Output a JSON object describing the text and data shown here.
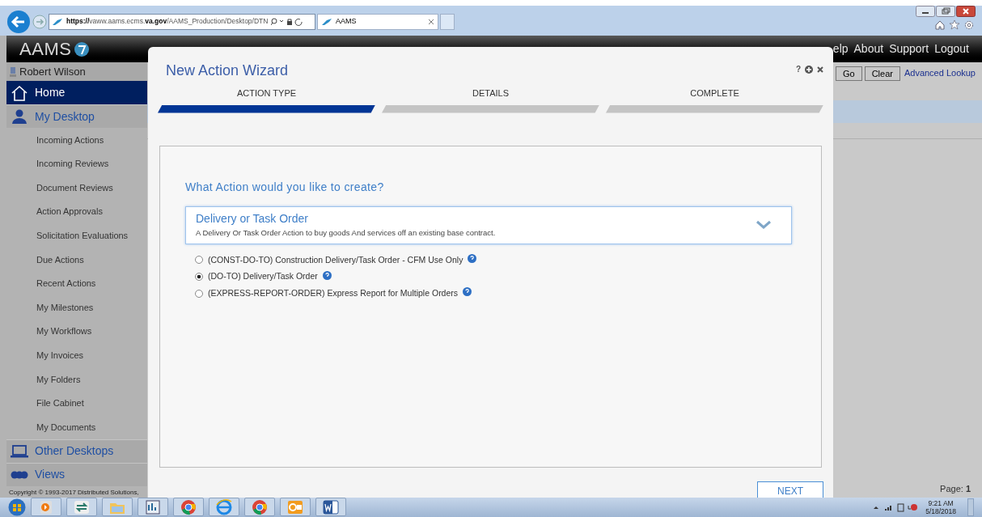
{
  "browser": {
    "address_parts": [
      "https://",
      "vaww.aams.ecms.",
      "va.gov",
      "/AAMS_Production/Desktop/DTN"
    ],
    "tab_title": "AAMS"
  },
  "header": {
    "logo": "AAMS",
    "links": [
      "elp",
      "About",
      "Support",
      "Logout"
    ]
  },
  "lookup": {
    "buttons": [
      "Go",
      "Clear"
    ],
    "link": "Advanced Lookup"
  },
  "sidebar": {
    "user": "Robert Wilson",
    "sections": [
      {
        "label": "Home",
        "selected": true
      },
      {
        "label": "My Desktop",
        "selected": false,
        "expanded": true,
        "children": [
          "Incoming Actions",
          "Incoming Reviews",
          "Document Reviews",
          "Action Approvals",
          "Solicitation Evaluations",
          "Due Actions",
          "Recent Actions",
          "My Milestones",
          "My Workflows",
          "My Invoices",
          "My Folders",
          "File Cabinet",
          "My Documents"
        ]
      },
      {
        "label": "Other Desktops",
        "selected": false
      },
      {
        "label": "Views",
        "selected": false
      }
    ],
    "copyright": "Copyright © 1993-2017 Distributed Solutions,"
  },
  "wizard": {
    "title": "New Action Wizard",
    "help": "?",
    "steps": [
      {
        "label": "ACTION TYPE",
        "selected": true
      },
      {
        "label": "DETAILS",
        "selected": false
      },
      {
        "label": "COMPLETE",
        "selected": false
      }
    ],
    "question": "What Action would you like to create?",
    "dropdown": {
      "title": "Delivery or Task Order",
      "description": "A Delivery Or Task Order Action to buy goods And services off an existing base contract."
    },
    "options": [
      {
        "label": "(CONST-DO-TO) Construction Delivery/Task Order - CFM Use Only",
        "selected": false
      },
      {
        "label": "(DO-TO) Delivery/Task Order",
        "selected": true
      },
      {
        "label": "(EXPRESS-REPORT-ORDER) Express Report for Multiple Orders",
        "selected": false
      }
    ],
    "next": "NEXT"
  },
  "page_label": "Page: **1**",
  "taskbar": {
    "time": "9:21 AM",
    "date": "5/18/2018"
  }
}
